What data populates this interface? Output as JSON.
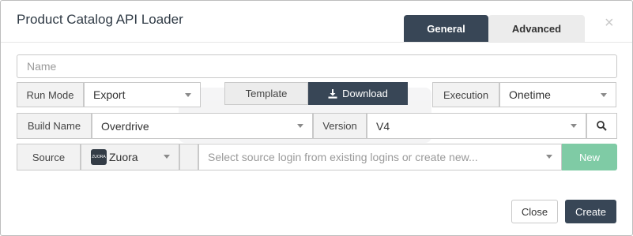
{
  "dialog": {
    "title": "Product Catalog API Loader",
    "close_glyph": "×",
    "tabs": [
      {
        "label": "General",
        "active": true
      },
      {
        "label": "Advanced",
        "active": false
      }
    ]
  },
  "form": {
    "name": {
      "placeholder": "Name",
      "value": ""
    },
    "run_mode": {
      "label": "Run Mode",
      "value": "Export"
    },
    "template": {
      "label": "Template"
    },
    "download": {
      "label": "Download",
      "icon": "download-icon"
    },
    "execution": {
      "label": "Execution",
      "value": "Onetime"
    },
    "build_name": {
      "label": "Build Name",
      "value": "Overdrive"
    },
    "version": {
      "label": "Version",
      "value": "V4"
    },
    "search": {
      "icon": "search-icon"
    },
    "source": {
      "label": "Source",
      "connector": "Zuora",
      "connector_logo_text": "ZUORA",
      "login_placeholder": "Select source login from existing logins or create new...",
      "new_label": "New"
    }
  },
  "footer": {
    "close_label": "Close",
    "create_label": "Create"
  },
  "colors": {
    "primary_dark": "#384656",
    "new_green": "#7fcba5",
    "label_bg": "#f2f2f2",
    "border": "#c9c9c9"
  }
}
